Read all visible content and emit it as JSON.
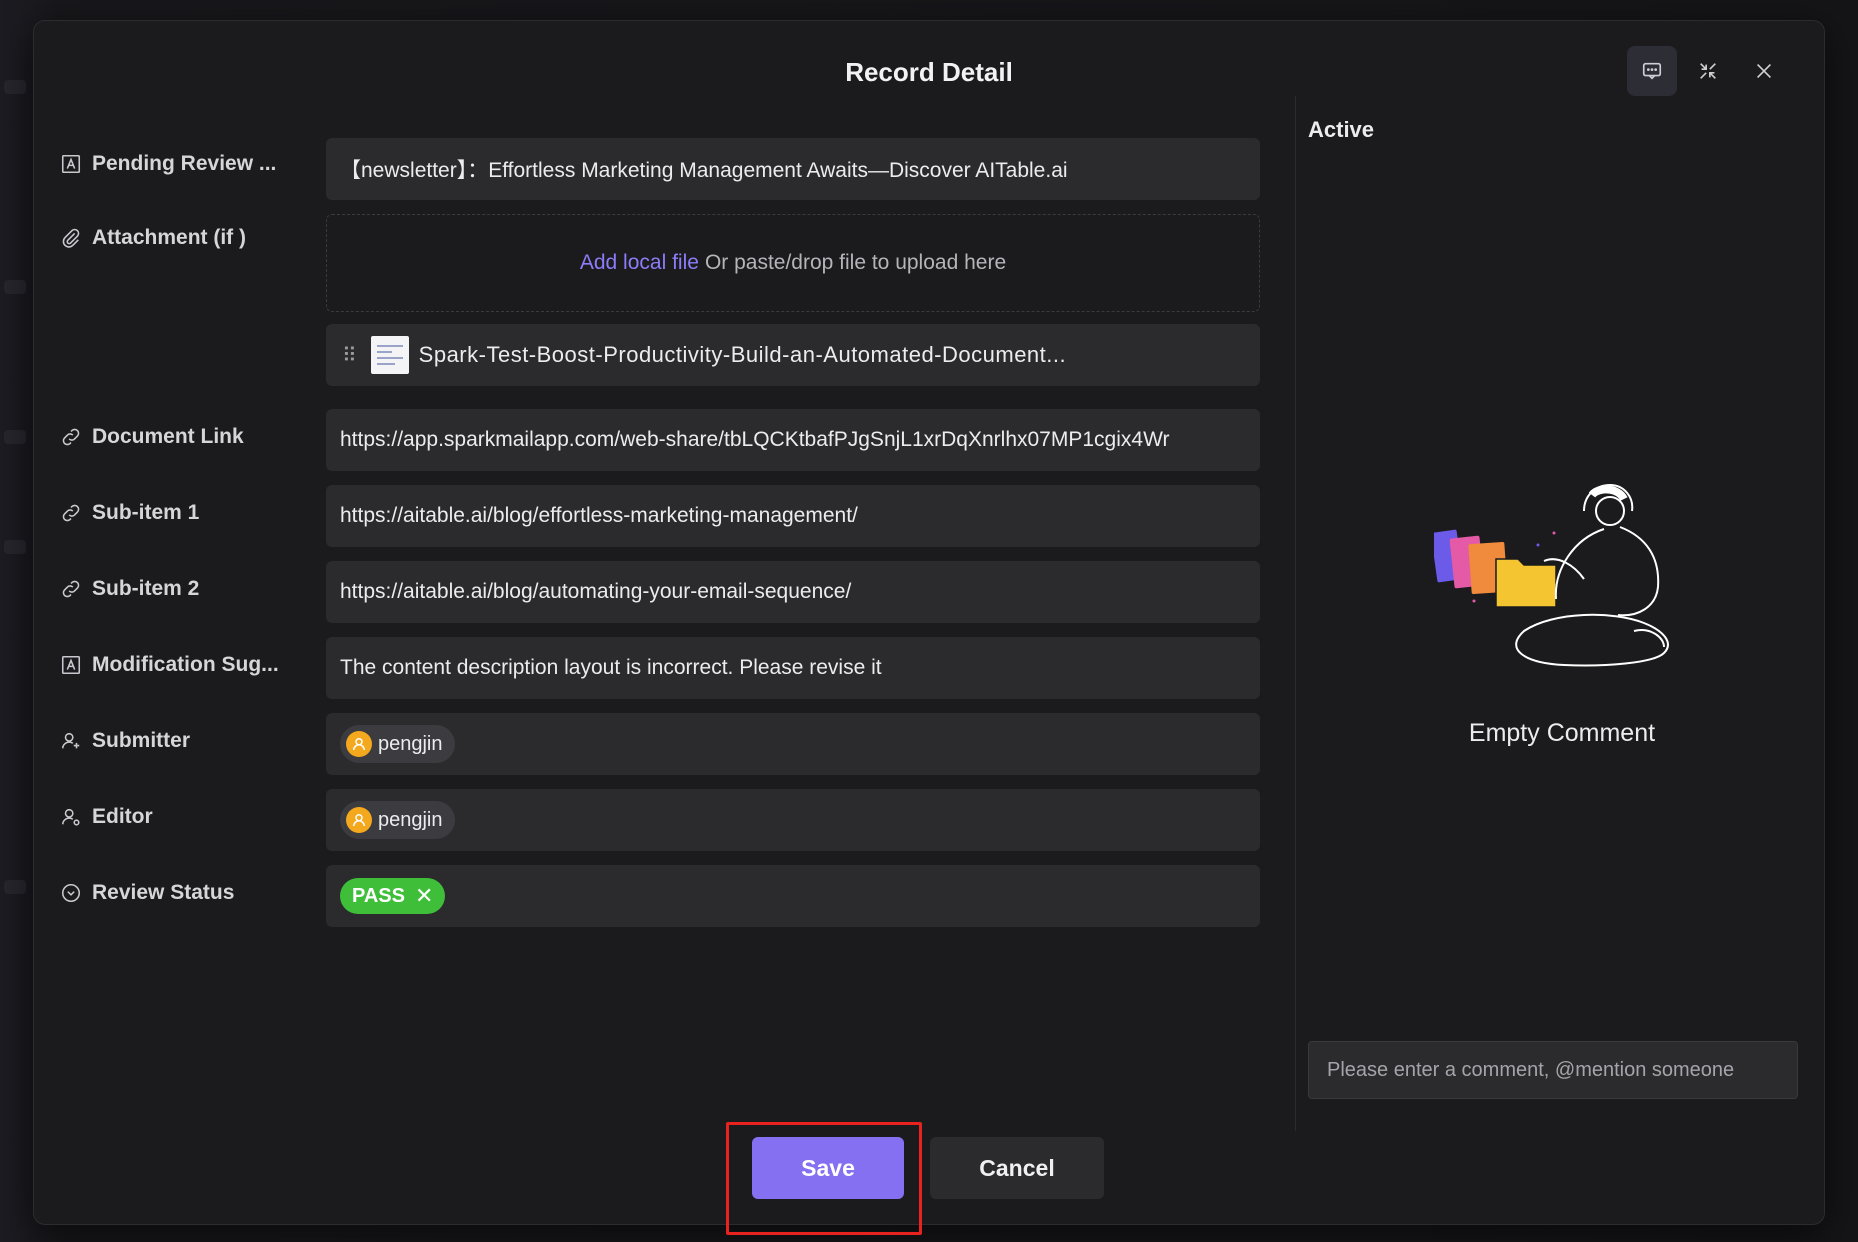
{
  "dialog": {
    "title": "Record Detail",
    "top_icons": [
      "comment-icon",
      "collapse-icon",
      "close-icon"
    ]
  },
  "fields": {
    "pending_review": {
      "label": "Pending Review ...",
      "icon": "text-field-icon",
      "value": "【newsletter】：Effortless Marketing Management Awaits—Discover AITable.ai"
    },
    "attachment": {
      "label": "Attachment (if )",
      "icon": "paperclip-icon",
      "upload_link": "Add local file",
      "upload_hint": "Or paste/drop file to upload here",
      "file_name": "Spark-Test-Boost-Productivity-Build-an-Automated-Document..."
    },
    "document_link": {
      "label": "Document Link",
      "icon": "link-icon",
      "value": "https://app.sparkmailapp.com/web-share/tbLQCKtbafPJgSnjL1xrDqXnrlhx07MP1cgix4Wr"
    },
    "sub_item_1": {
      "label": "Sub-item 1",
      "icon": "link-icon",
      "value": "https://aitable.ai/blog/effortless-marketing-management/"
    },
    "sub_item_2": {
      "label": "Sub-item 2",
      "icon": "link-icon",
      "value": "https://aitable.ai/blog/automating-your-email-sequence/"
    },
    "modification": {
      "label": "Modification Sug...",
      "icon": "text-field-icon",
      "value": "The content description layout is incorrect. Please revise it"
    },
    "submitter": {
      "label": "Submitter",
      "icon": "user-add-icon",
      "value": "pengjin"
    },
    "editor": {
      "label": "Editor",
      "icon": "user-edit-icon",
      "value": "pengjin"
    },
    "review_status": {
      "label": "Review Status",
      "icon": "single-select-icon",
      "value": "PASS",
      "tag_color": "#3fbe3a"
    }
  },
  "sidebar": {
    "title": "Active",
    "empty_text": "Empty Comment",
    "comment_placeholder": "Please enter a comment, @mention someone"
  },
  "footer": {
    "save_label": "Save",
    "cancel_label": "Cancel",
    "save_color": "#8670f2",
    "highlight_color": "#e8221f"
  }
}
